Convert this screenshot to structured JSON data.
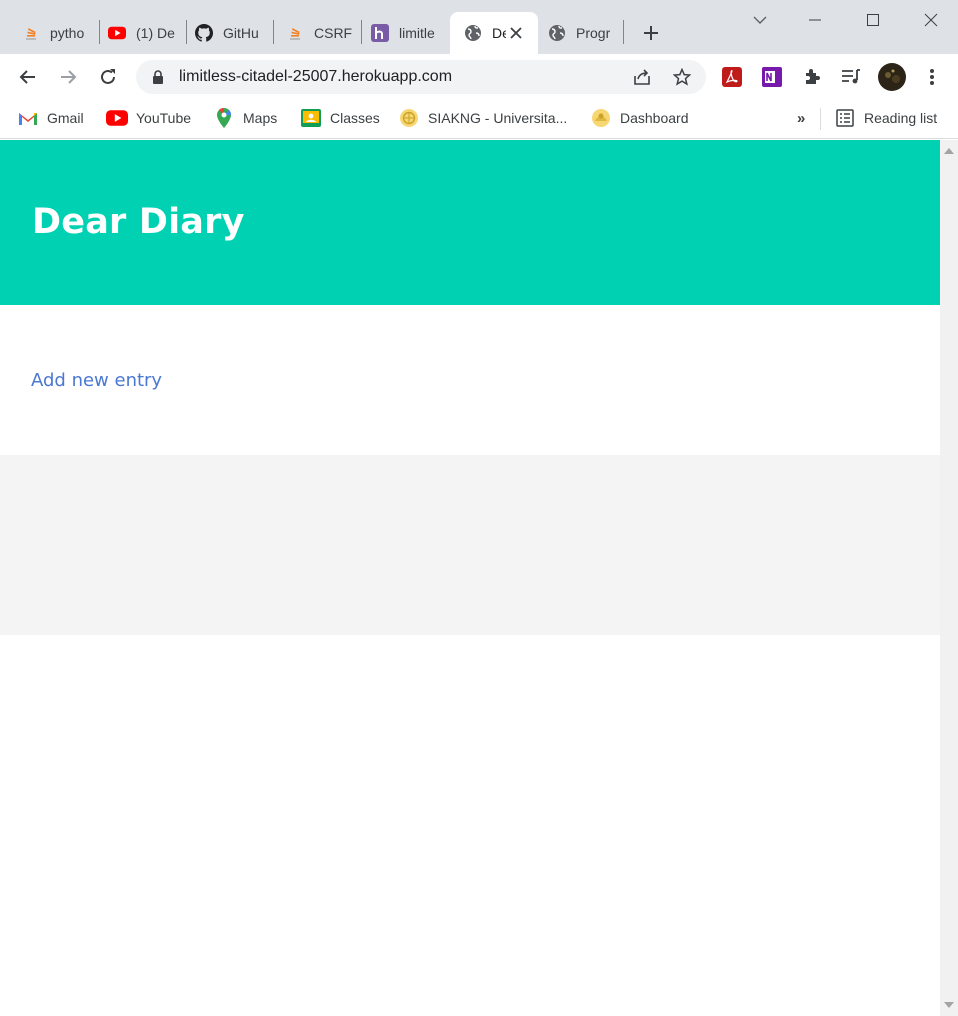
{
  "tabs": [
    {
      "title": "pytho",
      "icon": "stackoverflow-icon"
    },
    {
      "title": "(1) De",
      "icon": "youtube-icon"
    },
    {
      "title": "GitHu",
      "icon": "github-icon"
    },
    {
      "title": "CSRF",
      "icon": "stackoverflow-icon"
    },
    {
      "title": "limitle",
      "icon": "heroku-icon"
    },
    {
      "title": "De",
      "icon": "globe-icon",
      "active": true
    },
    {
      "title": "Progr",
      "icon": "globe-icon"
    }
  ],
  "address_bar": {
    "url": "limitless-citadel-25007.herokuapp.com"
  },
  "bookmarks": [
    {
      "label": "Gmail",
      "icon": "gmail-icon"
    },
    {
      "label": "YouTube",
      "icon": "youtube-icon"
    },
    {
      "label": "Maps",
      "icon": "maps-icon"
    },
    {
      "label": "Classes",
      "icon": "classroom-icon"
    },
    {
      "label": "SIAKNG - Universita...",
      "icon": "university-seal-icon"
    },
    {
      "label": "Dashboard",
      "icon": "university-seal-icon"
    }
  ],
  "bookmarks_overflow": "»",
  "reading_list": {
    "label": "Reading list"
  },
  "page": {
    "title": "Dear Diary",
    "add_entry_link": "Add new entry"
  },
  "colors": {
    "hero": "#00d1b2",
    "link": "#4a78d2",
    "footer": "#f4f4f4",
    "tabstrip": "#dee1e6"
  }
}
